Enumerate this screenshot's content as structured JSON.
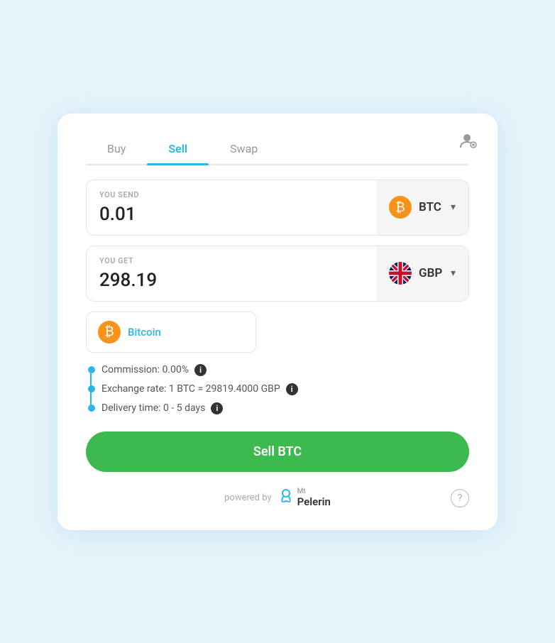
{
  "tabs": [
    {
      "id": "buy",
      "label": "Buy",
      "active": false
    },
    {
      "id": "sell",
      "label": "Sell",
      "active": true
    },
    {
      "id": "swap",
      "label": "Swap",
      "active": false
    }
  ],
  "send_section": {
    "label": "YOU SEND",
    "value": "0.01",
    "currency_code": "BTC",
    "currency_icon": "bitcoin"
  },
  "get_section": {
    "label": "YOU GET",
    "value": "298.19",
    "currency_code": "GBP",
    "currency_icon": "gbp"
  },
  "dropdown_suggestion": {
    "label": "Bitcoin"
  },
  "info_rows": [
    {
      "text": "Commission: 0.00%",
      "has_info": true
    },
    {
      "text": "Exchange rate: 1 BTC = 29819.4000 GBP",
      "has_info": true
    },
    {
      "text": "Delivery time: 0 - 5 days",
      "has_info": true
    }
  ],
  "sell_button": {
    "label": "Sell BTC"
  },
  "footer": {
    "powered_by": "powered by",
    "brand_mt": "Mt",
    "brand_name": "Pelerin"
  },
  "colors": {
    "accent_blue": "#29b6e8",
    "sell_green": "#3dba4e",
    "btc_orange": "#f7931a"
  }
}
